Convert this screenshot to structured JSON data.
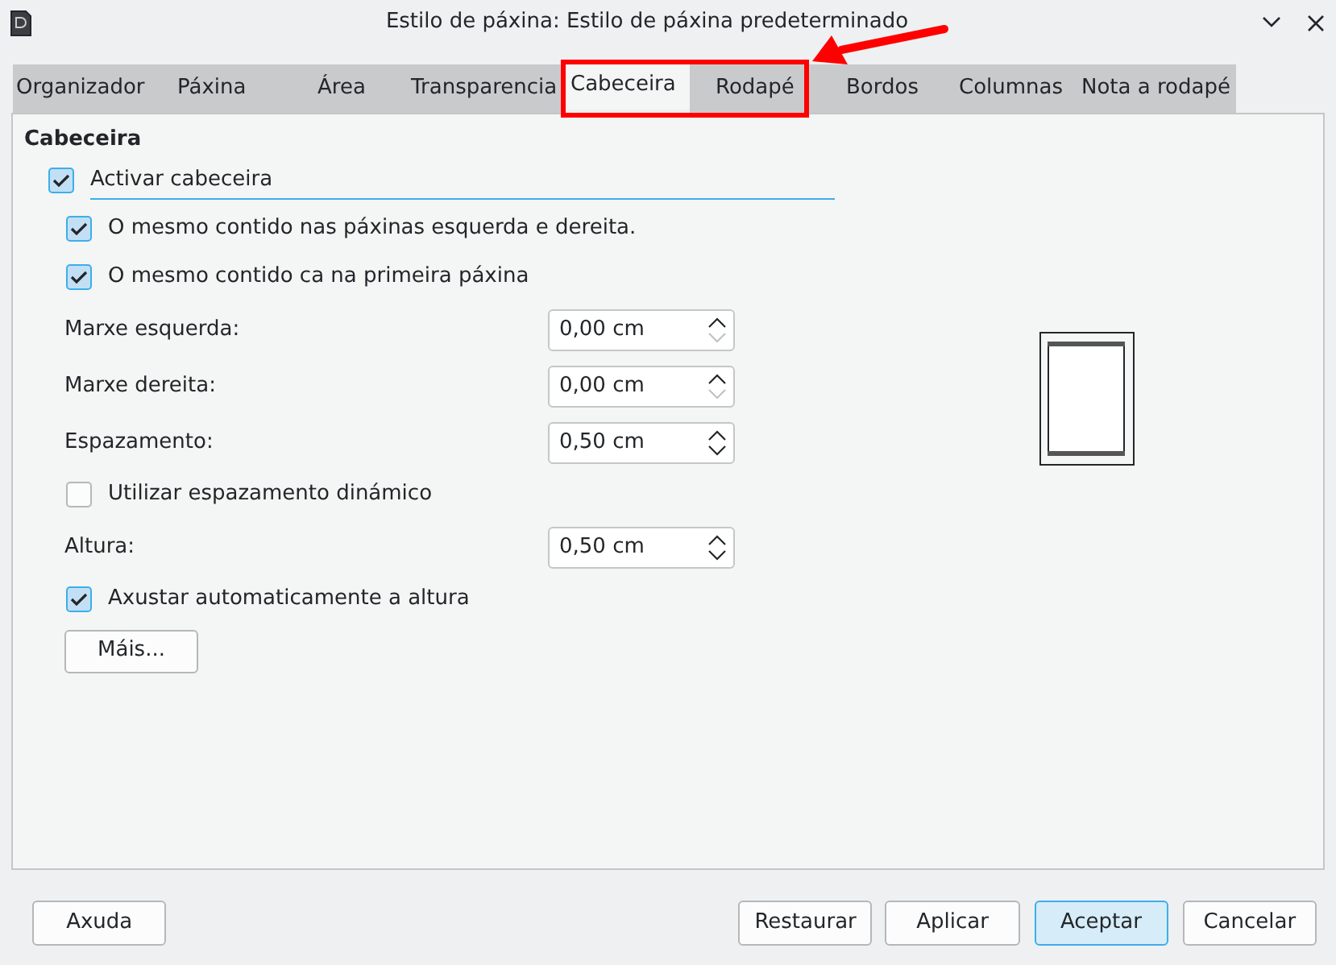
{
  "window": {
    "title": "Estilo de páxina: Estilo de páxina predeterminado"
  },
  "tabs": [
    {
      "label": "Organizador",
      "selected": false
    },
    {
      "label": "Páxina",
      "selected": false
    },
    {
      "label": "Área",
      "selected": false
    },
    {
      "label": "Transparencia",
      "selected": false
    },
    {
      "label": "Cabeceira",
      "selected": true
    },
    {
      "label": "Rodapé",
      "selected": false
    },
    {
      "label": "Bordos",
      "selected": false
    },
    {
      "label": "Columnas",
      "selected": false
    },
    {
      "label": "Nota a rodapé",
      "selected": false
    }
  ],
  "section": {
    "title": "Cabeceira"
  },
  "items": [
    {
      "kind": "checkbox",
      "label": "Activar cabeceira",
      "checked": true,
      "focused": true,
      "indent": false
    },
    {
      "kind": "checkbox",
      "label": "O mesmo contido nas páxinas esquerda e dereita.",
      "checked": true,
      "focused": false,
      "indent": true
    },
    {
      "kind": "checkbox",
      "label": "O mesmo contido ca na primeira páxina",
      "checked": true,
      "focused": false,
      "indent": true
    },
    {
      "kind": "spin",
      "label": "Marxe esquerda:",
      "value": "0,00 cm",
      "down_disabled": true
    },
    {
      "kind": "spin",
      "label": "Marxe dereita:",
      "value": "0,00 cm",
      "down_disabled": true
    },
    {
      "kind": "spin",
      "label": "Espazamento:",
      "value": "0,50 cm",
      "down_disabled": false
    },
    {
      "kind": "checkbox",
      "label": "Utilizar espazamento dinámico",
      "checked": false,
      "focused": false,
      "indent": true
    },
    {
      "kind": "spin",
      "label": "Altura:",
      "value": "0,50 cm",
      "down_disabled": false
    },
    {
      "kind": "checkbox",
      "label": "Axustar automaticamente a altura",
      "checked": true,
      "focused": false,
      "indent": true
    },
    {
      "kind": "button",
      "label": "Máis..."
    }
  ],
  "buttons": [
    {
      "label": "Axuda",
      "default": false
    },
    {
      "label": "Restaurar",
      "default": false
    },
    {
      "label": "Aplicar",
      "default": false
    },
    {
      "label": "Aceptar",
      "default": true
    },
    {
      "label": "Cancelar",
      "default": false
    }
  ],
  "annotations": {
    "highlight_frame": true,
    "pointer_arrow": true
  }
}
